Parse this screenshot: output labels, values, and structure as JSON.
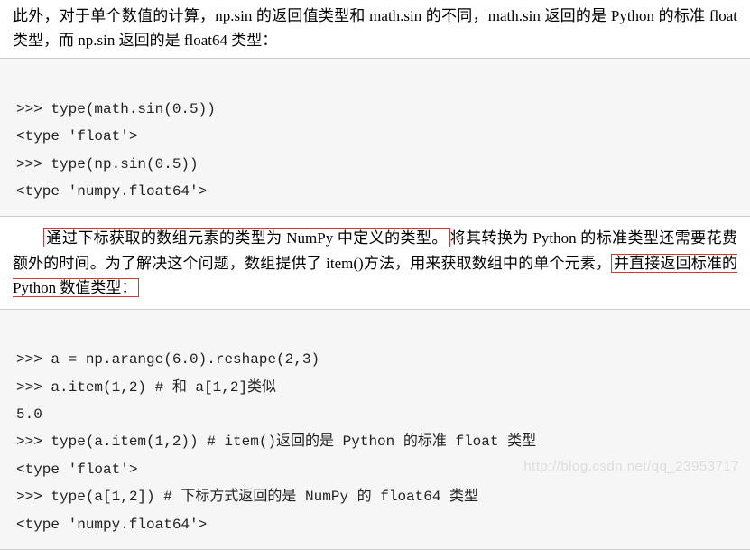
{
  "para1": {
    "t1": "此外，对于单个数值的计算，np.sin 的返回值类型和 math.sin 的不同，math.sin 返回的是 Python 的标准 float 类型，而 np.sin 返回的是 float64 类型："
  },
  "code1": {
    "l1": ">>> type(math.sin(0.5))",
    "l2": "<type 'float'>",
    "l3": ">>> type(np.sin(0.5))",
    "l4": "<type 'numpy.float64'>"
  },
  "para2": {
    "h1": "通过下标获取的数组元素的类型为 NumPy 中定义的类型。",
    "t1": "将其转换为 Python 的标准类型还需要花费额外的时间。为了解决这个问题，数组提供了 item()方法，用来获取数组中的单个元素，",
    "h2": "并直接返回标准的 Python 数值类型："
  },
  "code2": {
    "l1": ">>> a = np.arange(6.0).reshape(2,3)",
    "l2": ">>> a.item(1,2) # 和 a[1,2]类似",
    "l3": "5.0",
    "l4": ">>> type(a.item(1,2)) # item()返回的是 Python 的标准 float 类型",
    "l5": "<type 'float'>",
    "l6": ">>> type(a[1,2]) # 下标方式返回的是 NumPy 的 float64 类型",
    "l7": "<type 'numpy.float64'>"
  },
  "watermark": "http://blog.csdn.net/qq_23953717"
}
